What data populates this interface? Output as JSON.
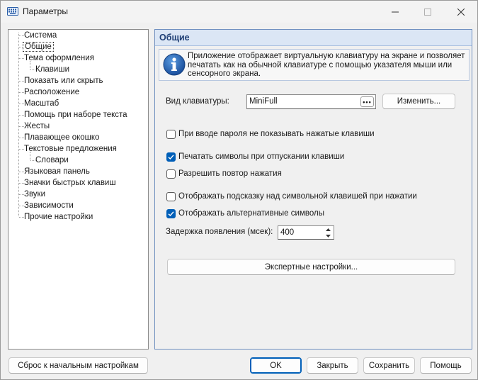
{
  "window": {
    "title": "Параметры",
    "icon": "keyboard-icon"
  },
  "tree": {
    "items": [
      {
        "label": "Система",
        "level": 0
      },
      {
        "label": "Общие",
        "level": 0,
        "selected": true
      },
      {
        "label": "Тема оформления",
        "level": 0
      },
      {
        "label": "Клавиши",
        "level": 1
      },
      {
        "label": "Показать или скрыть",
        "level": 0
      },
      {
        "label": "Расположение",
        "level": 0
      },
      {
        "label": "Масштаб",
        "level": 0
      },
      {
        "label": "Помощь при наборе текста",
        "level": 0
      },
      {
        "label": "Жесты",
        "level": 0
      },
      {
        "label": "Плавающее окошко",
        "level": 0
      },
      {
        "label": "Текстовые предложения",
        "level": 0
      },
      {
        "label": "Словари",
        "level": 1
      },
      {
        "label": "Языковая панель",
        "level": 0
      },
      {
        "label": "Значки быстрых клавиш",
        "level": 0
      },
      {
        "label": "Звуки",
        "level": 0
      },
      {
        "label": "Зависимости",
        "level": 0
      },
      {
        "label": "Прочие настройки",
        "level": 0
      }
    ]
  },
  "panel": {
    "title": "Общие",
    "info_text": "Приложение отображает виртуальную клавиатуру на экране и позволяет печатать как на обычной клавиатуре с помощью указателя мыши или сенсорного экрана.",
    "keyboard_type_label": "Вид клавиатуры:",
    "keyboard_type_value": "MiniFull",
    "combo_button_label": "•••",
    "change_button": "Изменить...",
    "checkboxes": [
      {
        "label": "При вводе пароля не показывать нажатые клавиши",
        "checked": false
      },
      {
        "label": "Печатать символы при отпускании клавиши",
        "checked": true
      },
      {
        "label": "Разрешить повтор нажатия",
        "checked": false
      },
      {
        "label": "Отображать подсказку над символьной клавишей при нажатии",
        "checked": false
      },
      {
        "label": "Отображать альтернативные символы",
        "checked": true
      }
    ],
    "delay_label": "Задержка появления (мсек):",
    "delay_value": "400",
    "expert_button": "Экспертные настройки..."
  },
  "footer": {
    "reset_button": "Сброс к начальным настройкам",
    "ok_button": "OK",
    "close_button": "Закрыть",
    "save_button": "Сохранить",
    "help_button": "Помощь"
  },
  "colors": {
    "accent": "#005fb8",
    "header_bg": "#dbe6f5",
    "header_text": "#1e3e74"
  }
}
